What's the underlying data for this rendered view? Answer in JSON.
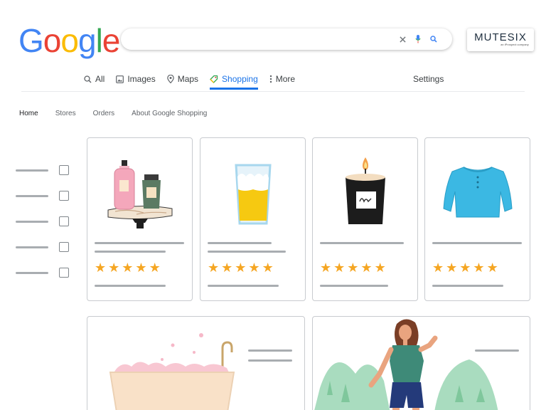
{
  "logo": {
    "text": "Google",
    "letters": [
      "G",
      "o",
      "o",
      "g",
      "l",
      "e"
    ],
    "colors": [
      "#4285F4",
      "#EA4335",
      "#FBBC05",
      "#4285F4",
      "#34A853",
      "#EA4335"
    ]
  },
  "search": {
    "value": "",
    "icons": [
      "clear-icon",
      "mic-icon",
      "search-icon"
    ]
  },
  "brand": {
    "name": "MUTESIX",
    "tagline": "an iProspect company"
  },
  "tabs": [
    {
      "label": "All",
      "icon": "search-icon",
      "active": false
    },
    {
      "label": "Images",
      "icon": "image-icon",
      "active": false
    },
    {
      "label": "Maps",
      "icon": "pin-icon",
      "active": false
    },
    {
      "label": "Shopping",
      "icon": "tag-icon",
      "active": true
    },
    {
      "label": "More",
      "icon": "more-vert-icon",
      "active": false
    }
  ],
  "settings": {
    "label": "Settings"
  },
  "subnav": [
    {
      "label": "Home",
      "current": true
    },
    {
      "label": "Stores",
      "current": false
    },
    {
      "label": "Orders",
      "current": false
    },
    {
      "label": "About Google Shopping",
      "current": false
    }
  ],
  "filters": {
    "count": 5,
    "checked": [
      false,
      false,
      false,
      false,
      false
    ]
  },
  "products": [
    {
      "name": "toiletries",
      "illustration": "bottles-icon",
      "rating": 5
    },
    {
      "name": "drink",
      "illustration": "glass-icon",
      "rating": 5
    },
    {
      "name": "candle",
      "illustration": "candle-icon",
      "rating": 5
    },
    {
      "name": "sweater",
      "illustration": "sweater-icon",
      "rating": 5
    }
  ],
  "stars": {
    "glyph": "★",
    "color": "#f5a623"
  },
  "accent": "#1a73e8"
}
